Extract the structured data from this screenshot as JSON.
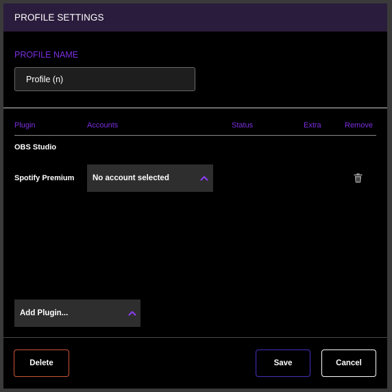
{
  "window": {
    "title": "PROFILE SETTINGS"
  },
  "profile": {
    "section_label": "PROFILE NAME",
    "name_value": "Profile (n)"
  },
  "table": {
    "headers": {
      "plugin": "Plugin",
      "accounts": "Accounts",
      "status": "Status",
      "extra": "Extra",
      "remove": "Remove"
    },
    "rows": [
      {
        "plugin": "OBS Studio"
      },
      {
        "plugin": "Spotify Premium",
        "account_selected": "No account selected",
        "remove_icon": "trash-icon"
      }
    ]
  },
  "add_plugin": {
    "label": "Add Plugin..."
  },
  "buttons": {
    "delete": "Delete",
    "save": "Save",
    "cancel": "Cancel"
  },
  "colors": {
    "accent": "#7b2fe0",
    "titlebar": "#2a1c3c",
    "delete_border": "#d0543a",
    "save_border": "#4a2fc0"
  },
  "icons": {
    "dropdown": "chevron-up-icon",
    "remove": "trash-icon"
  }
}
